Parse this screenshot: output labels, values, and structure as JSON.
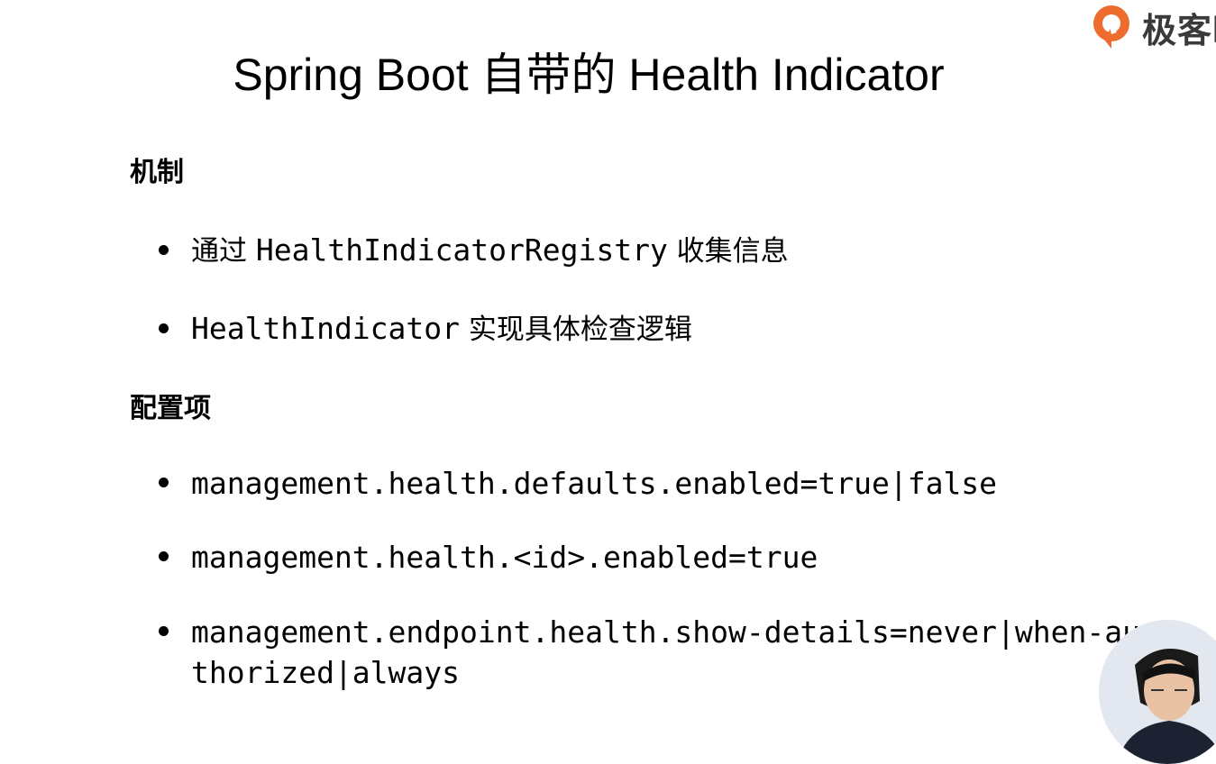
{
  "slide": {
    "title": "Spring Boot 自带的 Health Indicator"
  },
  "logo": {
    "brand_text": "极客时",
    "mark_color": "#ee6c2e"
  },
  "mechanism": {
    "heading": "机制",
    "items": [
      {
        "prefix": "通过 ",
        "code": "HealthIndicatorRegistry",
        "suffix": " 收集信息"
      },
      {
        "prefix": "",
        "code": "HealthIndicator",
        "suffix": " 实现具体检查逻辑"
      }
    ]
  },
  "config": {
    "heading": "配置项",
    "items": [
      "management.health.defaults.enabled=true|false",
      "management.health.<id>.enabled=true",
      "management.endpoint.health.show-details=never|when-authorized|always"
    ]
  }
}
